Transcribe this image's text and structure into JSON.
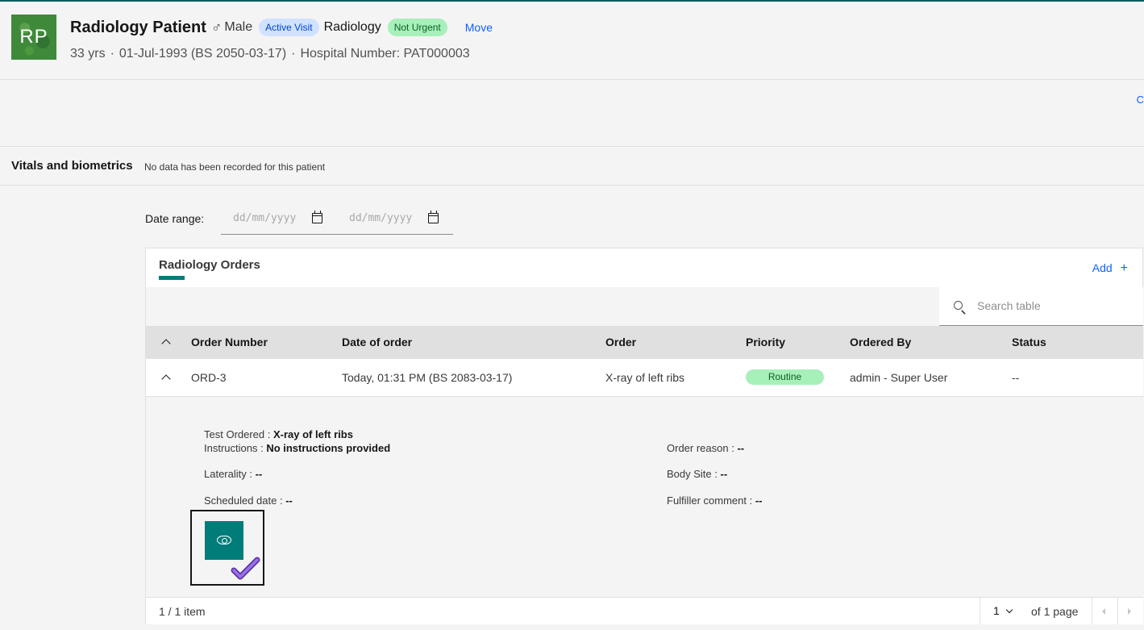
{
  "patient": {
    "initials": "RP",
    "name": "Radiology Patient",
    "gender_icon": "male-icon",
    "gender_symbol": "♂",
    "gender": "Male",
    "visit_tag": "Active Visit",
    "location": "Radiology",
    "urgency_tag": "Not Urgent",
    "move_label": "Move",
    "age": "33 yrs",
    "dob": "01-Jul-1993 (BS 2050-03-17)",
    "hospital_number": "Hospital Number: PAT000003",
    "separator": "·"
  },
  "band": {
    "edge_text": "C"
  },
  "vitals": {
    "title": "Vitals and biometrics",
    "note": "No data has been recorded for this patient"
  },
  "date_range": {
    "label": "Date range:",
    "start_placeholder": "dd/mm/yyyy",
    "end_placeholder": "dd/mm/yyyy"
  },
  "orders": {
    "title": "Radiology Orders",
    "add_label": "Add",
    "add_symbol": "+",
    "search_placeholder": "Search table",
    "columns": [
      "Order Number",
      "Date of order",
      "Order",
      "Priority",
      "Ordered By",
      "Status"
    ],
    "rows": [
      {
        "order_number": "ORD-3",
        "date": "Today, 01:31 PM (BS 2083-03-17)",
        "order": "X-ray of left ribs",
        "priority": "Routine",
        "ordered_by": "admin - Super User",
        "status": "--"
      }
    ],
    "details": {
      "test_ordered_label": "Test Ordered : ",
      "test_ordered_value": "X-ray of left ribs",
      "instructions_label": "Instructions : ",
      "instructions_value": "No instructions provided",
      "order_reason_label": "Order reason : ",
      "order_reason_value": "--",
      "laterality_label": "Laterality : ",
      "laterality_value": "--",
      "body_site_label": "Body Site : ",
      "body_site_value": "--",
      "scheduled_date_label": "Scheduled date : ",
      "scheduled_date_value": "--",
      "fulfiller_comment_label": "Fulfiller comment : ",
      "fulfiller_comment_value": "--"
    },
    "footer": {
      "items": "1 / 1 item",
      "page": "1",
      "of_pages": "of 1 page"
    }
  },
  "colors": {
    "accent_teal": "#007d79",
    "link_blue": "#0f62fe",
    "green_tag": "#a7f0ba",
    "blue_tag": "#d0e2ff",
    "check_purple": "#7b4fc9"
  }
}
